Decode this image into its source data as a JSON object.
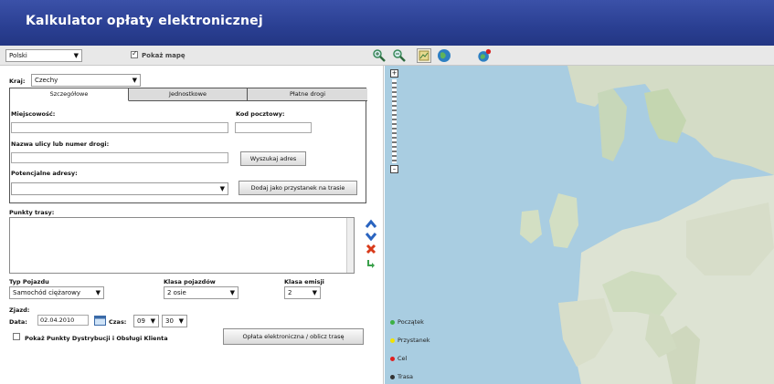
{
  "app": {
    "title": "Kalkulator opłaty elektronicznej"
  },
  "toolbar": {
    "language": "Polski",
    "map_view_label": "Pokaż mapę",
    "map_view_checked": true,
    "icons": [
      "zoom-in-icon",
      "zoom-out-icon",
      "map-extent-icon",
      "globe-icon",
      "globe-flag-icon"
    ]
  },
  "form": {
    "country_label": "Kraj:",
    "country_value": "Czechy",
    "tabs": [
      "Szczegółowe",
      "Jednostkowe",
      "Płatne drogi"
    ],
    "active_tab": 0,
    "city_label": "Miejscowość:",
    "postcode_label": "Kod pocztowy:",
    "street_label": "Nazwa ulicy lub numer drogi:",
    "search_button": "Wyszukaj adres",
    "potential_addresses_label": "Potencjalne adresy:",
    "add_stop_button": "Dodaj jako przystanek na trasie",
    "route_points_label": "Punkty trasy:",
    "vehicle_type_label": "Typ Pojazdu",
    "vehicle_type_value": "Samochód ciężarowy",
    "axle_class_label": "Klasa pojazdów",
    "axle_class_value": "2 osie",
    "emission_class_label": "Klasa emisji",
    "emission_class_value": "2",
    "departure_label": "Zjazd:",
    "date_label": "Data:",
    "date_value": "02.04.2010",
    "time_label": "Czas:",
    "hour_value": "09",
    "minute_value": "30",
    "show_points_label": "Pokaż Punkty Dystrybucji i Obsługi Klienta",
    "show_points_checked": false,
    "calculate_button": "Opłata elektroniczna / oblicz trasę"
  },
  "map": {
    "legend": [
      {
        "label": "Początek",
        "color": "#3cb043"
      },
      {
        "label": "Przystanek",
        "color": "#f2e200"
      },
      {
        "label": "Cel",
        "color": "#e02020"
      },
      {
        "label": "Trasa",
        "color": "#333333"
      }
    ]
  }
}
